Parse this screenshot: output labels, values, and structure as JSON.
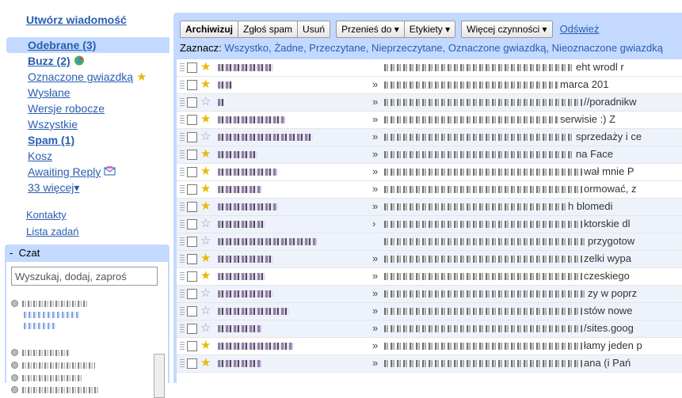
{
  "sidebar": {
    "compose": "Utwórz wiadomość",
    "items": [
      {
        "label": "Odebrane (3)",
        "selected": true,
        "bold": true
      },
      {
        "label": "Buzz (2)",
        "bold": true,
        "icon": "buzz-icon"
      },
      {
        "label": "Oznaczone gwiazdką",
        "icon": "star-icon"
      },
      {
        "label": "Wysłane"
      },
      {
        "label": "Wersje robocze"
      },
      {
        "label": "Wszystkie"
      },
      {
        "label": "Spam (1)",
        "bold": true
      },
      {
        "label": "Kosz"
      },
      {
        "label": "Awaiting Reply",
        "icon": "label-icon"
      },
      {
        "label": "33 więcej▾"
      }
    ],
    "contacts": "Kontakty",
    "tasks": "Lista zadań"
  },
  "chat": {
    "title": "Czat",
    "collapse": "-",
    "search_placeholder": "Wyszukaj, dodaj, zaproś"
  },
  "toolbar": {
    "archive": "Archiwizuj",
    "spam": "Zgłoś spam",
    "delete": "Usuń",
    "move": "Przenieś do ▾",
    "labels": "Etykiety ▾",
    "more": "Więcej czynności ▾",
    "refresh": "Odśwież"
  },
  "select": {
    "label": "Zaznacz:",
    "options": "Wszystko, Żadne, Przeczytane, Nieprzeczytane, Oznaczone gwiazdką, Nieoznaczone gwiazdką"
  },
  "colors": {
    "accent": "#c3d9ff",
    "link": "#2a5db0",
    "star": "#e8b90c"
  },
  "messages": [
    {
      "starred": true,
      "arrow": "",
      "tail": "eht wrodl r"
    },
    {
      "starred": true,
      "arrow": "»",
      "tail": "marca 201"
    },
    {
      "starred": false,
      "arrow": "»",
      "tail": "//poradnikw"
    },
    {
      "starred": true,
      "arrow": "»",
      "tail": "serwisie :) Z"
    },
    {
      "starred": false,
      "arrow": "»",
      "tail": "sprzedaży i ce"
    },
    {
      "starred": true,
      "arrow": "»",
      "tail": "na Face"
    },
    {
      "starred": true,
      "arrow": "»",
      "tail": "wał mnie P"
    },
    {
      "starred": true,
      "arrow": "»",
      "tail": "ormować, z"
    },
    {
      "starred": true,
      "arrow": "»",
      "tail": "h blomedi"
    },
    {
      "starred": false,
      "arrow": "›",
      "tail": "ktorskie dl"
    },
    {
      "starred": false,
      "arrow": "",
      "tail": "przygotow"
    },
    {
      "starred": true,
      "arrow": "»",
      "tail": "zelki wypa"
    },
    {
      "starred": true,
      "arrow": "»",
      "tail": "czeskiego"
    },
    {
      "starred": false,
      "arrow": "»",
      "tail": "zy w poprz"
    },
    {
      "starred": false,
      "arrow": "»",
      "tail": "stów nowe"
    },
    {
      "starred": false,
      "arrow": "»",
      "tail": "/sites.goog"
    },
    {
      "starred": true,
      "arrow": "»",
      "tail": "łamy jeden p"
    },
    {
      "starred": true,
      "arrow": "»",
      "tail": "ana (i Pań"
    }
  ]
}
